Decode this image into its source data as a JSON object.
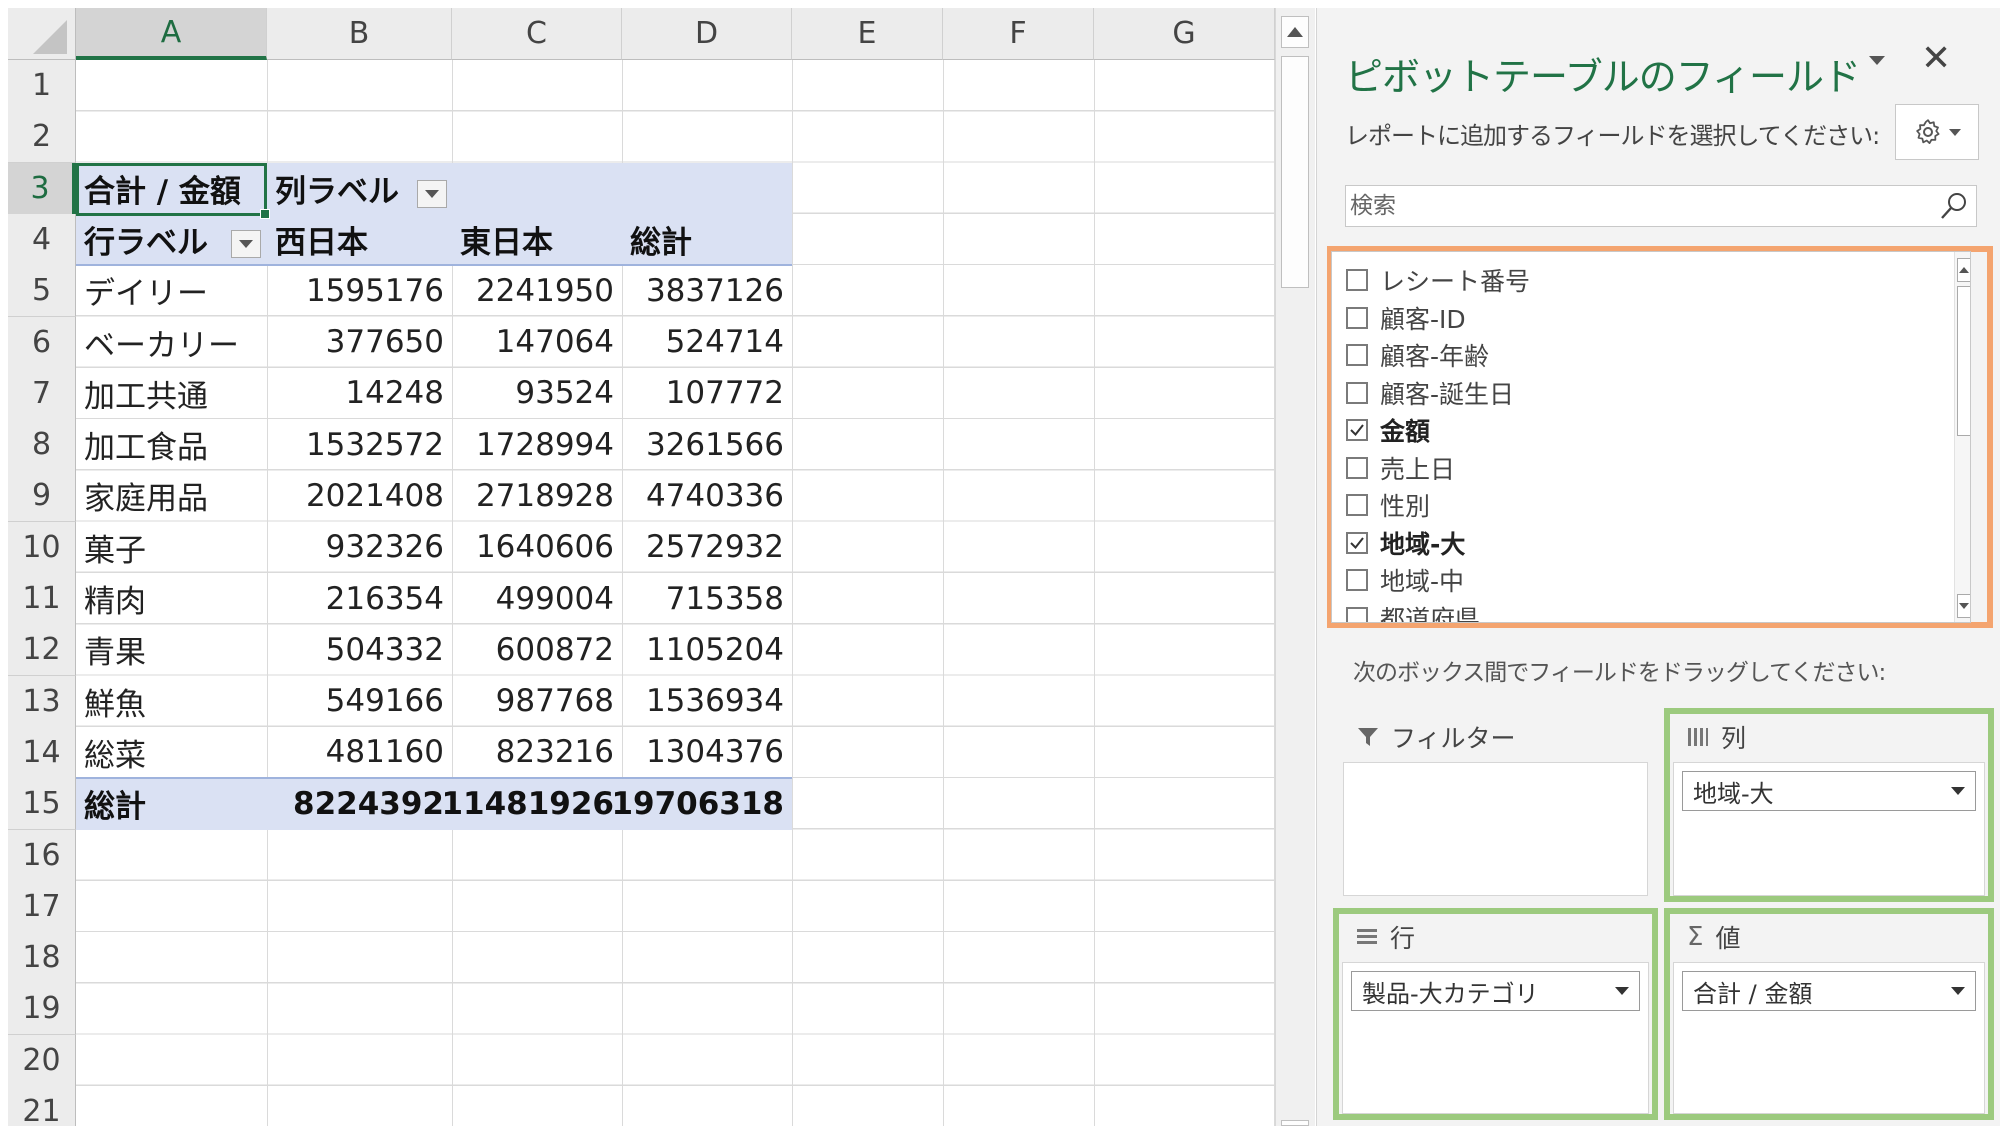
{
  "sheet": {
    "columns": [
      "A",
      "B",
      "C",
      "D",
      "E",
      "F",
      "G"
    ],
    "active_column": "A",
    "rows": [
      "1",
      "2",
      "3",
      "4",
      "5",
      "6",
      "7",
      "8",
      "9",
      "10",
      "11",
      "12",
      "13",
      "14",
      "15",
      "16",
      "17",
      "18",
      "19",
      "20",
      "21"
    ],
    "active_row": "3"
  },
  "pivot": {
    "value_header": "合計 / 金額",
    "column_labels": "列ラベル",
    "row_labels": "行ラベル",
    "column_headers": [
      "西日本",
      "東日本",
      "総計"
    ],
    "rows": [
      {
        "label": "デイリー",
        "values": [
          "1595176",
          "2241950",
          "3837126"
        ]
      },
      {
        "label": "ベーカリー",
        "values": [
          "377650",
          "147064",
          "524714"
        ]
      },
      {
        "label": "加工共通",
        "values": [
          "14248",
          "93524",
          "107772"
        ]
      },
      {
        "label": "加工食品",
        "values": [
          "1532572",
          "1728994",
          "3261566"
        ]
      },
      {
        "label": "家庭用品",
        "values": [
          "2021408",
          "2718928",
          "4740336"
        ]
      },
      {
        "label": "菓子",
        "values": [
          "932326",
          "1640606",
          "2572932"
        ]
      },
      {
        "label": "精肉",
        "values": [
          "216354",
          "499004",
          "715358"
        ]
      },
      {
        "label": "青果",
        "values": [
          "504332",
          "600872",
          "1105204"
        ]
      },
      {
        "label": "鮮魚",
        "values": [
          "549166",
          "987768",
          "1536934"
        ]
      },
      {
        "label": "総菜",
        "values": [
          "481160",
          "823216",
          "1304376"
        ]
      }
    ],
    "total": {
      "label": "総計",
      "values": [
        "8224392",
        "11481926",
        "19706318"
      ]
    }
  },
  "pane": {
    "title": "ピボットテーブルのフィールド",
    "subtitle": "レポートに追加するフィールドを選択してください:",
    "search_placeholder": "検索",
    "fields": [
      {
        "label": "レシート番号",
        "checked": false
      },
      {
        "label": "顧客-ID",
        "checked": false
      },
      {
        "label": "顧客-年齢",
        "checked": false
      },
      {
        "label": "顧客-誕生日",
        "checked": false
      },
      {
        "label": "金額",
        "checked": true
      },
      {
        "label": "売上日",
        "checked": false
      },
      {
        "label": "性別",
        "checked": false
      },
      {
        "label": "地域-大",
        "checked": true
      },
      {
        "label": "地域-中",
        "checked": false
      },
      {
        "label": "都道府県",
        "checked": false
      }
    ],
    "drag_hint": "次のボックス間でフィールドをドラッグしてください:",
    "areas": {
      "filter": {
        "title": "フィルター"
      },
      "columns": {
        "title": "列",
        "field": "地域-大"
      },
      "rows": {
        "title": "行",
        "field": "製品-大カテゴリ"
      },
      "values": {
        "title": "値",
        "field": "合計 / 金額"
      }
    }
  },
  "colors": {
    "excel_green": "#217346",
    "pivot_band": "#dae1f3",
    "highlight_orange": "#f4a46f",
    "highlight_green": "#9cca7e"
  }
}
